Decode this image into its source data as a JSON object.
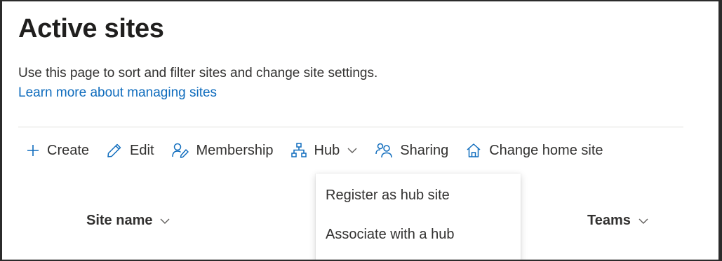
{
  "page": {
    "title": "Active sites",
    "description": "Use this page to sort and filter sites and change site settings.",
    "learn_more": "Learn more about managing sites"
  },
  "toolbar": {
    "create": "Create",
    "edit": "Edit",
    "membership": "Membership",
    "hub": "Hub",
    "sharing": "Sharing",
    "change_home": "Change home site"
  },
  "hub_menu": {
    "items": [
      "Register as hub site",
      "Associate with a hub"
    ]
  },
  "columns": {
    "site_name": "Site name",
    "teams": "Teams"
  },
  "colors": {
    "accent": "#0f6cbd",
    "text": "#323130"
  },
  "icons": [
    "add-icon",
    "pencil-icon",
    "people-edit-icon",
    "org-chart-icon",
    "chevron-down-icon",
    "people-share-icon",
    "home-icon"
  ]
}
